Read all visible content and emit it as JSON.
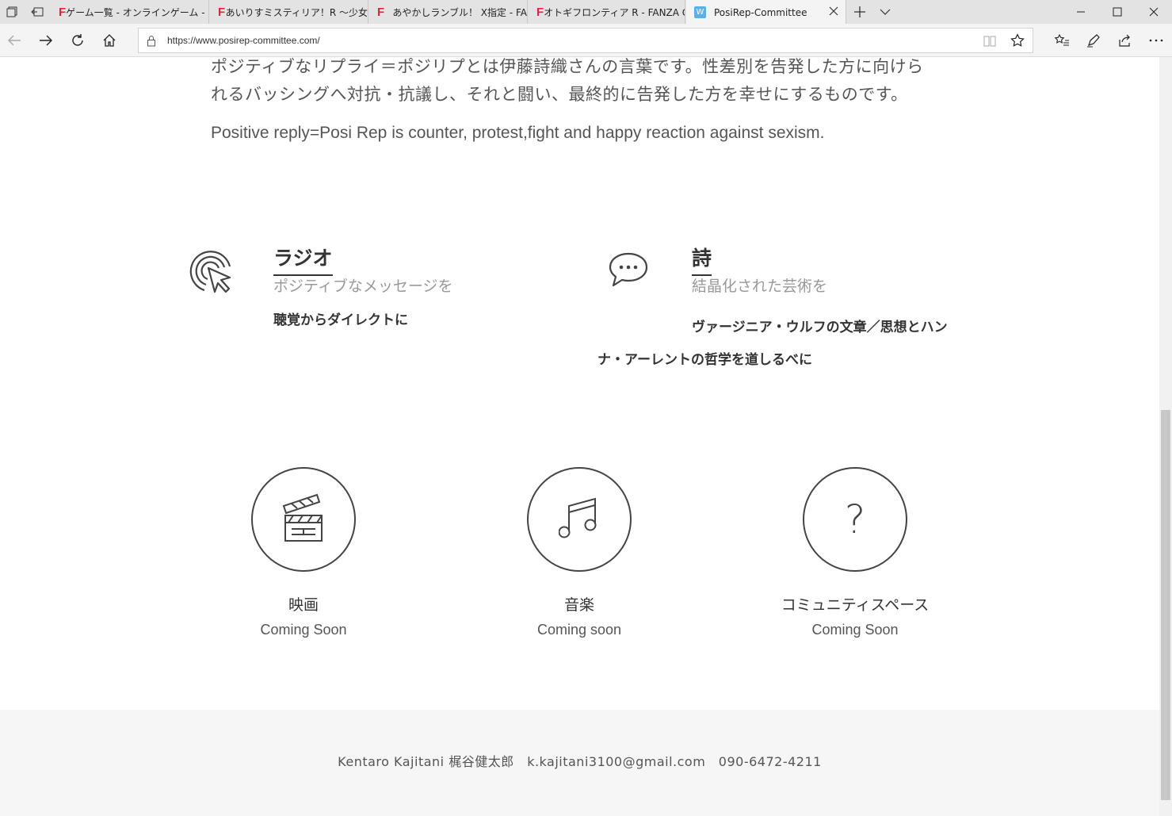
{
  "browser": {
    "tabs": [
      {
        "title": "ゲーム一覧 - オンラインゲーム - I",
        "favicon": "F"
      },
      {
        "title": "あいりすミスティリア！R ～少女",
        "favicon": "F"
      },
      {
        "title": "あやかしランブル！ X指定 - FA",
        "favicon": "F"
      },
      {
        "title": "オトギフロンティア R - FANZA G",
        "favicon": "F"
      },
      {
        "title": "PosiRep-Committee",
        "favicon": "W"
      }
    ],
    "address": "https://www.posirep-committee.com/",
    "colors": {
      "fanza_favicon": "#e0243b",
      "wix_favicon": "#5cb0e8"
    }
  },
  "intro": {
    "jp_line1": "ポジティブなリプライ＝ポジリプとは伊藤詩織さんの言葉です。性差別を告発した方に向けら",
    "jp_line2": "れるバッシングへ対抗・抗議し、それと闘い、最終的に告発した方を幸せにするものです。",
    "en": "Positive reply=Posi Rep is counter, protest,fight and happy reaction against sexism."
  },
  "features": [
    {
      "icon": "pointer-click-icon",
      "title": "ラジオ",
      "subtitle": "ポジティブなメッセージを",
      "desc1": "聴覚からダイレクトに",
      "desc2": ""
    },
    {
      "icon": "speech-bubble-icon",
      "title": "詩",
      "subtitle": "結晶化された芸術を",
      "desc1": "ヴァージニア・ウルフの文章／思想とハン",
      "desc2": "ナ・アーレントの哲学を道しるべに"
    }
  ],
  "services": [
    {
      "icon": "clapperboard-icon",
      "name": "映画",
      "status": "Coming Soon"
    },
    {
      "icon": "music-note-icon",
      "name": "音楽",
      "status": "Coming soon"
    },
    {
      "icon": "question-icon",
      "name": "コミュニティスペース",
      "status": "Coming Soon",
      "glyph": "?"
    }
  ],
  "footer": {
    "contact": "Kentaro Kajitani 梶谷健太郎　k.kajitani3100@gmail.com　090-6472-4211"
  }
}
